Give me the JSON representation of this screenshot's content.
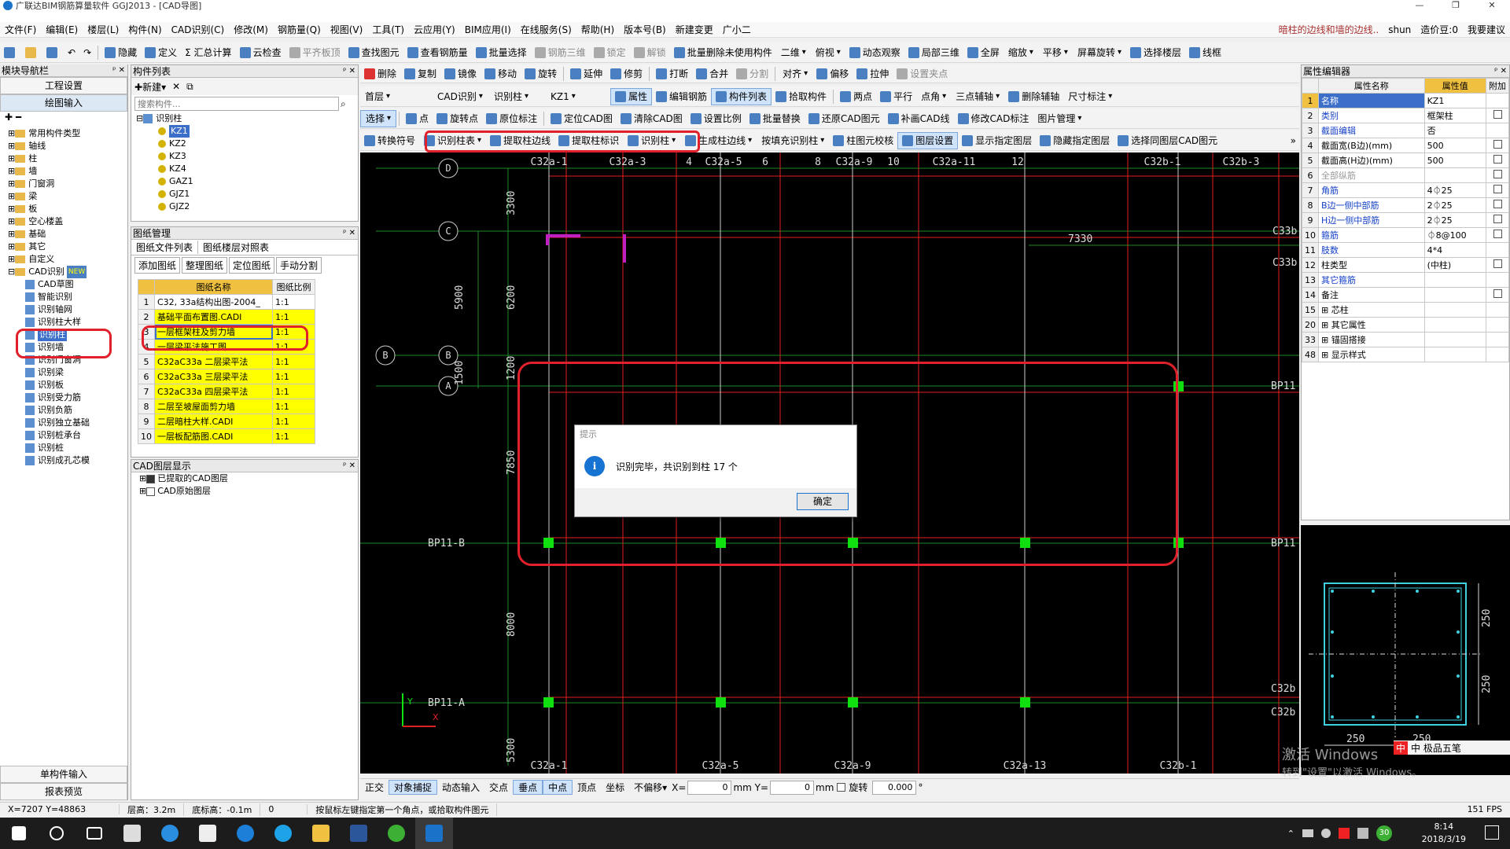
{
  "window": {
    "title": "广联达BIM钢筋算量软件 GGJ2013 - [CAD导图]",
    "right_title": "暗柱的边线和墙的边线..",
    "user": "shun",
    "price_beans": "造价豆:0",
    "help_link": "我要建议",
    "controls": [
      "—",
      "❐",
      "✕"
    ]
  },
  "menu": [
    "文件(F)",
    "编辑(E)",
    "楼层(L)",
    "构件(N)",
    "CAD识别(C)",
    "修改(M)",
    "钢筋量(Q)",
    "视图(V)",
    "工具(T)",
    "云应用(Y)",
    "BIM应用(I)",
    "在线服务(S)",
    "帮助(H)",
    "版本号(B)",
    "新建变更",
    "广小二"
  ],
  "toolbar1": [
    "隐藏",
    "定义",
    "Σ 汇总计算",
    "云检查",
    "平齐板顶",
    "查找图元",
    "查看钢筋量",
    "批量选择",
    "钢筋三维",
    "锁定",
    "解锁",
    "批量删除未使用构件",
    "二维",
    "俯视",
    "动态观察",
    "局部三维",
    "全屏",
    "缩放",
    "平移",
    "屏幕旋转",
    "选择楼层",
    "线框"
  ],
  "toolbar2": [
    "删除",
    "复制",
    "镜像",
    "移动",
    "旋转",
    "延伸",
    "修剪",
    "打断",
    "合并",
    "分割",
    "对齐",
    "偏移",
    "拉伸",
    "设置夹点"
  ],
  "toolbar3": {
    "floor": "首层",
    "cad_recog": "CAD识别",
    "recog_col": "识别柱",
    "comp": "KZ1",
    "items": [
      "属性",
      "编辑钢筋",
      "构件列表",
      "拾取构件",
      "两点",
      "平行",
      "点角",
      "三点辅轴",
      "删除辅轴",
      "尺寸标注"
    ]
  },
  "toolbar4": [
    "选择",
    "点",
    "旋转点",
    "原位标注",
    "定位CAD图",
    "清除CAD图",
    "设置比例",
    "批量替换",
    "还原CAD图元",
    "补画CAD线",
    "修改CAD标注",
    "图片管理"
  ],
  "toolbar5": [
    "转换符号",
    "识别柱表",
    "提取柱边线",
    "提取柱标识",
    "识别柱",
    "生成柱边线",
    "按填充识别柱",
    "柱图元校核",
    "图层设置",
    "显示指定图层",
    "隐藏指定图层",
    "选择同图层CAD图元"
  ],
  "nav": {
    "title": "模块导航栏",
    "btn1": "工程设置",
    "btn2": "绘图输入",
    "tree": [
      "常用构件类型",
      "轴线",
      "柱",
      "墙",
      "门窗洞",
      "梁",
      "板",
      "空心楼盖",
      "基础",
      "其它",
      "自定义",
      "CAD识别"
    ],
    "new_badge": "NEW",
    "cad_items": [
      "CAD草图",
      "智能识别",
      "识别轴网",
      "识别柱大样",
      "识别柱",
      "识别墙",
      "识别门窗洞",
      "识别梁",
      "识别板",
      "识别受力筋",
      "识别负筋",
      "识别独立基础",
      "识别桩承台",
      "识别桩",
      "识别成孔芯模"
    ],
    "btn3": "单构件输入",
    "btn4": "报表预览"
  },
  "comp_list": {
    "title": "构件列表",
    "new_btn": "新建",
    "search_placeholder": "搜索构件...",
    "root": "识别柱",
    "items": [
      "KZ1",
      "KZ2",
      "KZ3",
      "KZ4",
      "GAZ1",
      "GJZ1",
      "GJZ2"
    ]
  },
  "drawing_mgmt": {
    "title": "图纸管理",
    "tabs": [
      "图纸文件列表",
      "图纸楼层对照表"
    ],
    "buttons": [
      "添加图纸",
      "整理图纸",
      "定位图纸",
      "手动分割"
    ],
    "col_name": "图纸名称",
    "col_scale": "图纸比例",
    "rows": [
      {
        "n": "1",
        "name": "C32, 33a结构出图-2004_",
        "scale": "1:1"
      },
      {
        "n": "2",
        "name": "基础平面布置图.CADI",
        "scale": "1:1"
      },
      {
        "n": "3",
        "name": "一层框架柱及剪力墙",
        "scale": "1:1"
      },
      {
        "n": "4",
        "name": "一层梁平法施工图",
        "scale": "1:1"
      },
      {
        "n": "5",
        "name": "C32aC33a 二层梁平法",
        "scale": "1:1"
      },
      {
        "n": "6",
        "name": "C32aC33a 三层梁平法",
        "scale": "1:1"
      },
      {
        "n": "7",
        "name": "C32aC33a 四层梁平法",
        "scale": "1:1"
      },
      {
        "n": "8",
        "name": "二层至坡屋面剪力墙",
        "scale": "1:1"
      },
      {
        "n": "9",
        "name": "二层暗柱大样.CADI",
        "scale": "1:1"
      },
      {
        "n": "10",
        "name": "一层板配筋图.CADI",
        "scale": "1:1"
      }
    ]
  },
  "cad_layers": {
    "title": "CAD图层显示",
    "items": [
      "已提取的CAD图层",
      "CAD原始图层"
    ]
  },
  "drawing": {
    "top_labels": [
      "C32a-1",
      "C32a-3",
      "4",
      "C32a-5",
      "6",
      "8",
      "C32a-9",
      "10",
      "C32a-11",
      "12",
      "C32b-1",
      "C32b-3"
    ],
    "bottom_labels": [
      "C32a-1",
      "C32a-5",
      "C32a-9",
      "C32a-13",
      "C32b-1"
    ],
    "left_axes": [
      "D",
      "C",
      "B",
      "B",
      "A"
    ],
    "bp_labels": [
      "BP11-B",
      "BP11-A"
    ],
    "right_labels": [
      "C33b",
      "C33b",
      "BP11",
      "BP11",
      "C32b",
      "C32b"
    ],
    "dims": [
      "3300",
      "5900",
      "6200",
      "1500",
      "1200",
      "7850",
      "8000",
      "5300",
      "7330"
    ]
  },
  "dialog": {
    "title": "提示",
    "icon": "i",
    "message": "识别完毕，共识别到柱 17 个",
    "ok": "确定"
  },
  "prop_editor": {
    "title": "属性编辑器",
    "col_name": "属性名称",
    "col_value": "属性值",
    "col_extra": "附加",
    "rows": [
      {
        "n": "1",
        "name": "名称",
        "value": "KZ1",
        "style": "blue",
        "chk": false
      },
      {
        "n": "2",
        "name": "类别",
        "value": "框架柱",
        "style": "blue",
        "chk": true
      },
      {
        "n": "3",
        "name": "截面编辑",
        "value": "否",
        "style": "blue",
        "chk": false
      },
      {
        "n": "4",
        "name": "截面宽(B边)(mm)",
        "value": "500",
        "style": "",
        "chk": true
      },
      {
        "n": "5",
        "name": "截面高(H边)(mm)",
        "value": "500",
        "style": "",
        "chk": true
      },
      {
        "n": "6",
        "name": "全部纵筋",
        "value": "",
        "style": "gray",
        "chk": true
      },
      {
        "n": "7",
        "name": "角筋",
        "value": "4⏀25",
        "style": "blue",
        "chk": true
      },
      {
        "n": "8",
        "name": "B边一侧中部筋",
        "value": "2⏀25",
        "style": "blue",
        "chk": true
      },
      {
        "n": "9",
        "name": "H边一侧中部筋",
        "value": "2⏀25",
        "style": "blue",
        "chk": true
      },
      {
        "n": "10",
        "name": "箍筋",
        "value": "⏀8@100",
        "style": "blue",
        "chk": true
      },
      {
        "n": "11",
        "name": "肢数",
        "value": "4*4",
        "style": "blue",
        "chk": false
      },
      {
        "n": "12",
        "name": "柱类型",
        "value": "(中柱)",
        "style": "",
        "chk": true
      },
      {
        "n": "13",
        "name": "其它箍筋",
        "value": "",
        "style": "blue",
        "chk": false
      },
      {
        "n": "14",
        "name": "备注",
        "value": "",
        "style": "",
        "chk": true
      },
      {
        "n": "15",
        "name": "⊞ 芯柱",
        "value": "",
        "style": "",
        "chk": false
      },
      {
        "n": "20",
        "name": "⊞ 其它属性",
        "value": "",
        "style": "",
        "chk": false
      },
      {
        "n": "33",
        "name": "⊞ 锚固搭接",
        "value": "",
        "style": "",
        "chk": false
      },
      {
        "n": "48",
        "name": "⊞ 显示样式",
        "value": "",
        "style": "",
        "chk": false
      }
    ],
    "section_dims": [
      "250",
      "250",
      "250",
      "250"
    ]
  },
  "snapbar": {
    "items": [
      "正交",
      "对象捕捉",
      "动态输入",
      "交点",
      "垂点",
      "中点",
      "顶点",
      "坐标"
    ],
    "offset": "不偏移",
    "x_label": "X=",
    "x_val": "0",
    "y_label": "mm Y=",
    "y_val": "0",
    "mm": "mm",
    "rotate": "旋转",
    "rotate_val": "0.000",
    "deg": "°"
  },
  "status": {
    "coords": "X=7207 Y=48863",
    "floor_height": "层高：3.2m",
    "bottom_elev": "底标高：-0.1m",
    "zero": "0",
    "hint": "按鼠标左键指定第一个角点，或拾取构件图元",
    "fps": "151 FPS"
  },
  "watermark": {
    "line1": "激活 Windows",
    "line2": "转到\"设置\"以激活 Windows。"
  },
  "ime": "中 极品五笔",
  "taskbar": {
    "time": "8:14",
    "date": "2018/3/19",
    "badge": "30"
  }
}
